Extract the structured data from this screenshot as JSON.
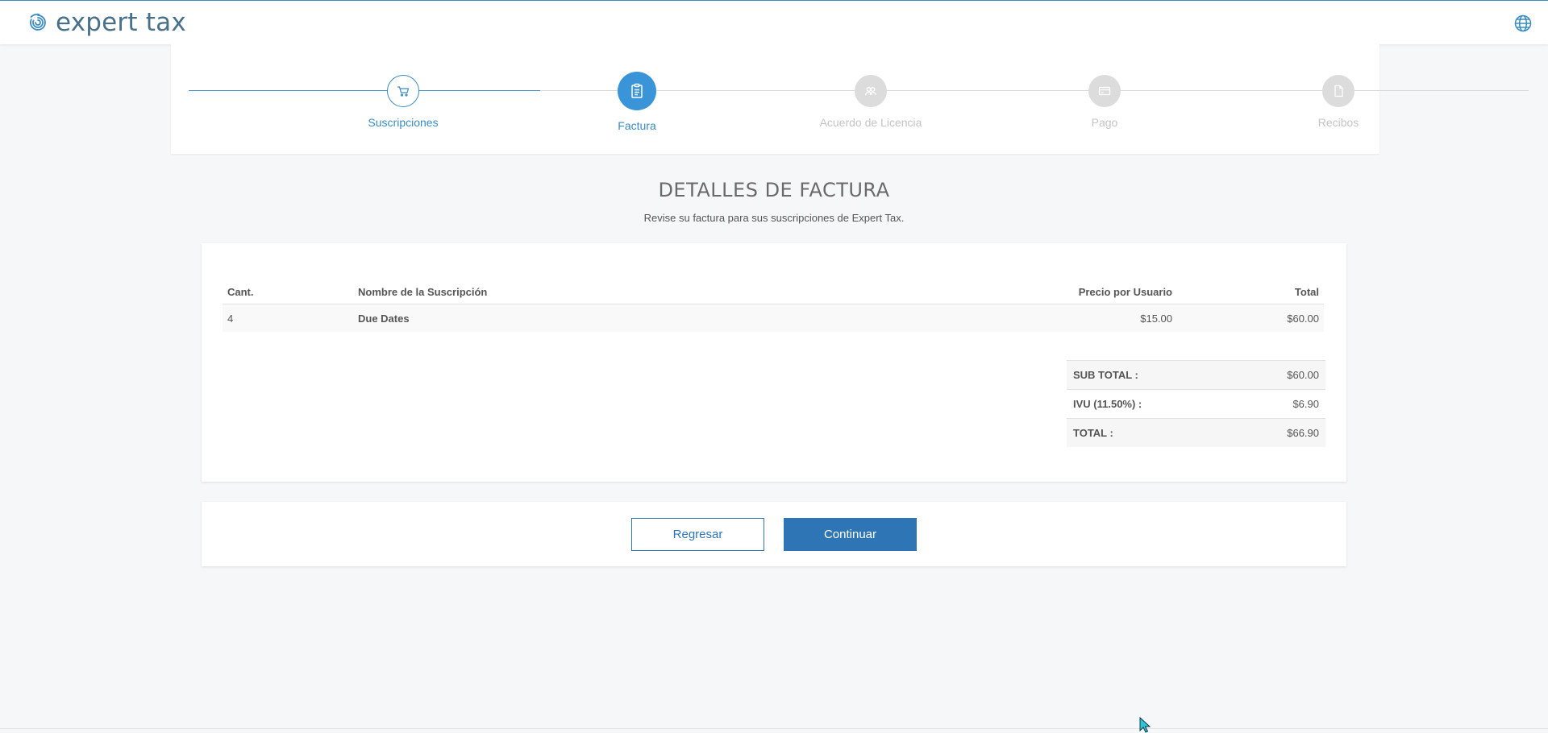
{
  "app": {
    "brand": "expert tax",
    "colors": {
      "accent": "#3a8cc4",
      "primary_button": "#2e75b6",
      "inactive_step": "#dcdcdc"
    }
  },
  "header": {
    "logo_icon": "spiral-logo-icon",
    "language_icon": "globe-icon"
  },
  "steps": [
    {
      "label": "Suscripciones",
      "icon": "cart-icon",
      "state": "completed"
    },
    {
      "label": "Factura",
      "icon": "clipboard-icon",
      "state": "current"
    },
    {
      "label": "Acuerdo de Licencia",
      "icon": "users-icon",
      "state": "pending"
    },
    {
      "label": "Pago",
      "icon": "credit-card-icon",
      "state": "pending"
    },
    {
      "label": "Recibos",
      "icon": "document-icon",
      "state": "pending"
    }
  ],
  "page": {
    "title": "DETALLES DE FACTURA",
    "subtitle": "Revise su factura para sus suscripciones de Expert Tax."
  },
  "invoice": {
    "columns": {
      "qty": "Cant.",
      "name": "Nombre de la Suscripción",
      "price": "Precio por Usuario",
      "total": "Total"
    },
    "rows": [
      {
        "qty": "4",
        "name": "Due Dates",
        "price": "$15.00",
        "total": "$60.00"
      }
    ],
    "totals": {
      "subtotal_label": "SUB TOTAL :",
      "subtotal_value": "$60.00",
      "tax_label": "IVU (11.50%) :",
      "tax_value": "$6.90",
      "total_label": "TOTAL :",
      "total_value": "$66.90"
    }
  },
  "actions": {
    "back_label": "Regresar",
    "continue_label": "Continuar"
  }
}
